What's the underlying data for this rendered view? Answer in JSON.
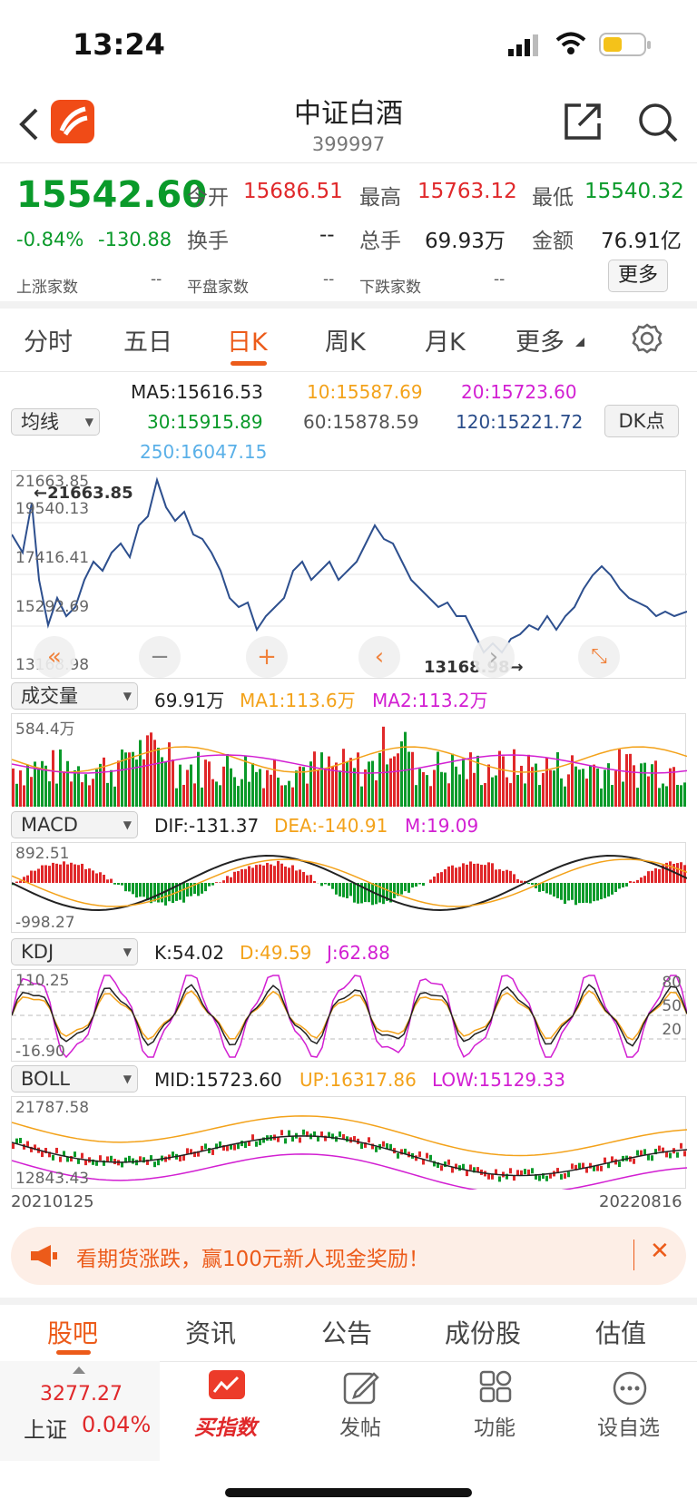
{
  "status": {
    "time": "13:24"
  },
  "header": {
    "title": "中证白酒",
    "code": "399997"
  },
  "quote": {
    "price": "15542.60",
    "change_pct": "-0.84%",
    "change_abs": "-130.88",
    "open_label": "今开",
    "open": "15686.51",
    "high_label": "最高",
    "high": "15763.12",
    "low_label": "最低",
    "low": "15540.32",
    "turnover_label": "换手",
    "turnover": "--",
    "volume_label": "总手",
    "volume": "69.93万",
    "amount_label": "金额",
    "amount": "76.91亿",
    "up_label": "上涨家数",
    "up": "--",
    "flat_label": "平盘家数",
    "flat": "--",
    "down_label": "下跌家数",
    "down": "--",
    "more_button": "更多"
  },
  "tabs": [
    {
      "label": "分时"
    },
    {
      "label": "五日"
    },
    {
      "label": "日K"
    },
    {
      "label": "周K"
    },
    {
      "label": "月K"
    },
    {
      "label": "更多"
    }
  ],
  "ma": {
    "select": "均线",
    "ma5": "MA5:15616.53",
    "ma10": "10:15587.69",
    "ma20": "20:15723.60",
    "ma30": "30:15915.89",
    "ma60": "60:15878.59",
    "ma120": "120:15221.72",
    "ma250": "250:16047.15",
    "dk_button": "DK点"
  },
  "main_chart": {
    "y_top": "21663.85",
    "y_2": "19540.13",
    "y_3": "17416.41",
    "y_4": "15292.69",
    "y_bottom": "13168.98",
    "max_marker": "←21663.85",
    "min_marker": "13168.98→"
  },
  "volume": {
    "select": "成交量",
    "value": "69.91万",
    "ma1": "MA1:113.6万",
    "ma2": "MA2:113.2万",
    "y_top": "584.4万"
  },
  "macd": {
    "select": "MACD",
    "dif": "DIF:-131.37",
    "dea": "DEA:-140.91",
    "m": "M:19.09",
    "y_top": "892.51",
    "y_bottom": "-998.27"
  },
  "kdj": {
    "select": "KDJ",
    "k": "K:54.02",
    "d": "D:49.59",
    "j": "J:62.88",
    "y_top": "110.25",
    "y_bottom": "-16.90",
    "r80": "80",
    "r50": "50",
    "r20": "20"
  },
  "boll": {
    "select": "BOLL",
    "mid": "MID:15723.60",
    "up": "UP:16317.86",
    "low": "LOW:15129.33",
    "y_top": "21787.58",
    "y_bottom": "12843.43",
    "date_start": "20210125",
    "date_end": "20220816"
  },
  "ad": {
    "text": "看期货涨跌，赢100元新人现金奖励！"
  },
  "bottom_tabs": [
    {
      "label": "股吧"
    },
    {
      "label": "资讯"
    },
    {
      "label": "公告"
    },
    {
      "label": "成份股"
    },
    {
      "label": "估值"
    }
  ],
  "dock": {
    "index_value": "3277.27",
    "index_name": "上证",
    "index_pct": "0.04%",
    "buy_label": "买指数",
    "post_label": "发帖",
    "func_label": "功能",
    "fav_label": "设自选"
  }
}
